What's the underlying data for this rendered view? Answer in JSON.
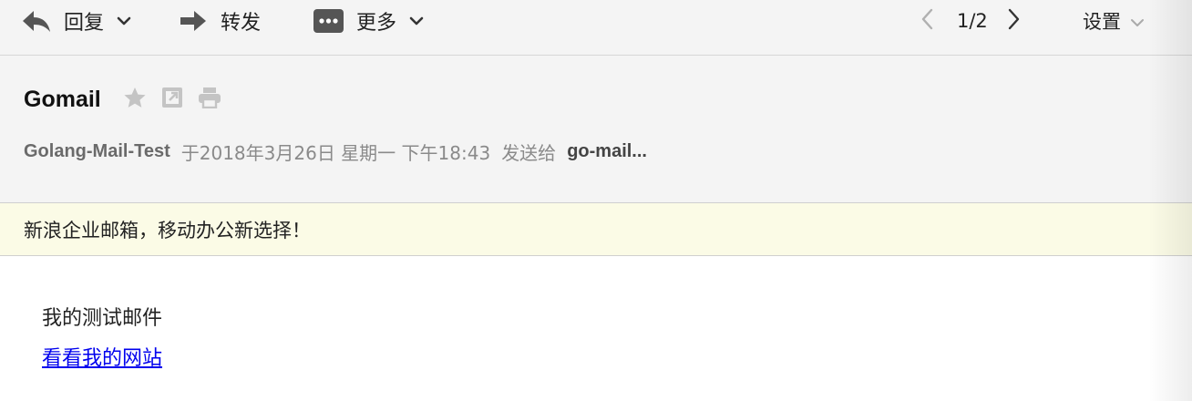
{
  "toolbar": {
    "reply_label": "回复",
    "forward_label": "转发",
    "more_label": "更多",
    "pagination": "1/2",
    "settings_label": "设置"
  },
  "message": {
    "subject": "Gomail",
    "sender": "Golang-Mail-Test",
    "sent_on": "于2018年3月26日 星期一 下午18:43",
    "sent_to_label": "发送给",
    "recipient": "go-mail..."
  },
  "banner": {
    "text": "新浪企业邮箱，移动办公新选择！"
  },
  "body": {
    "text": "我的测试邮件",
    "link_text": "看看我的网站"
  },
  "icons": {
    "reply": "reply-arrow-icon",
    "forward": "forward-arrow-icon",
    "more": "more-dots-icon",
    "star": "star-icon",
    "popout": "popout-icon",
    "print": "print-icon",
    "prev": "chevron-left-icon",
    "next": "chevron-right-icon"
  },
  "colors": {
    "toolbar_bg": "#f4f4f4",
    "banner_bg": "#fbfbe6",
    "link": "#0000ee"
  }
}
